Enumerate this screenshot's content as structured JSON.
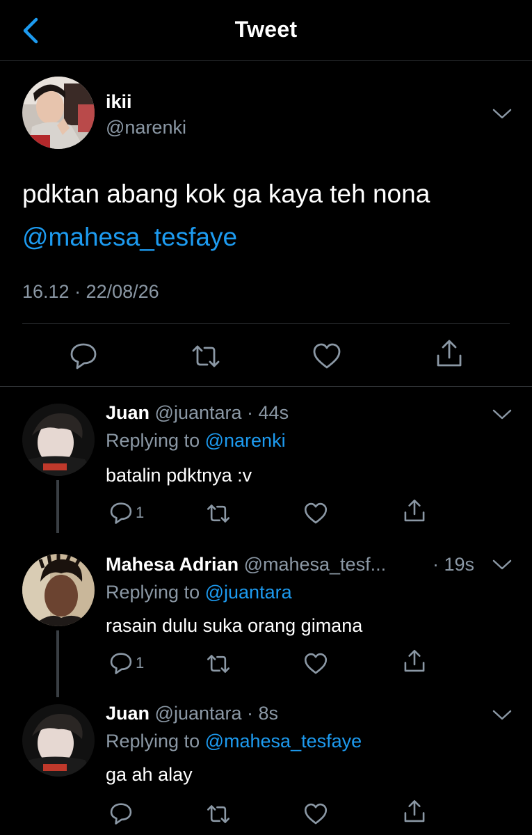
{
  "header": {
    "title": "Tweet"
  },
  "main_tweet": {
    "author_name": "ikii",
    "author_handle": "@narenki",
    "text": "pdktan abang kok ga kaya teh nona",
    "mention": "@mahesa_tesfaye",
    "timestamp": "16.12 · 22/08/26"
  },
  "replies": [
    {
      "name": "Juan",
      "handle": "@juantara",
      "time": "· 44s",
      "replying_prefix": "Replying to",
      "replying_to": "@narenki",
      "text": "batalin pdktnya :v",
      "reply_count": "1"
    },
    {
      "name": "Mahesa Adrian",
      "handle": "@mahesa_tesf...",
      "time": "· 19s",
      "replying_prefix": "Replying to",
      "replying_to": "@juantara",
      "text": "rasain dulu suka orang gimana",
      "reply_count": "1"
    },
    {
      "name": "Juan",
      "handle": "@juantara",
      "time": "· 8s",
      "replying_prefix": "Replying to",
      "replying_to": "@mahesa_tesfaye",
      "text": "ga ah alay",
      "reply_count": ""
    }
  ],
  "colors": {
    "accent": "#1d9bf0",
    "muted": "#8b98a5",
    "background": "#000000",
    "divider": "#2f3336"
  },
  "icons": [
    "back-chevron-icon",
    "chevron-down-icon",
    "reply-icon",
    "retweet-icon",
    "like-icon",
    "share-icon"
  ]
}
